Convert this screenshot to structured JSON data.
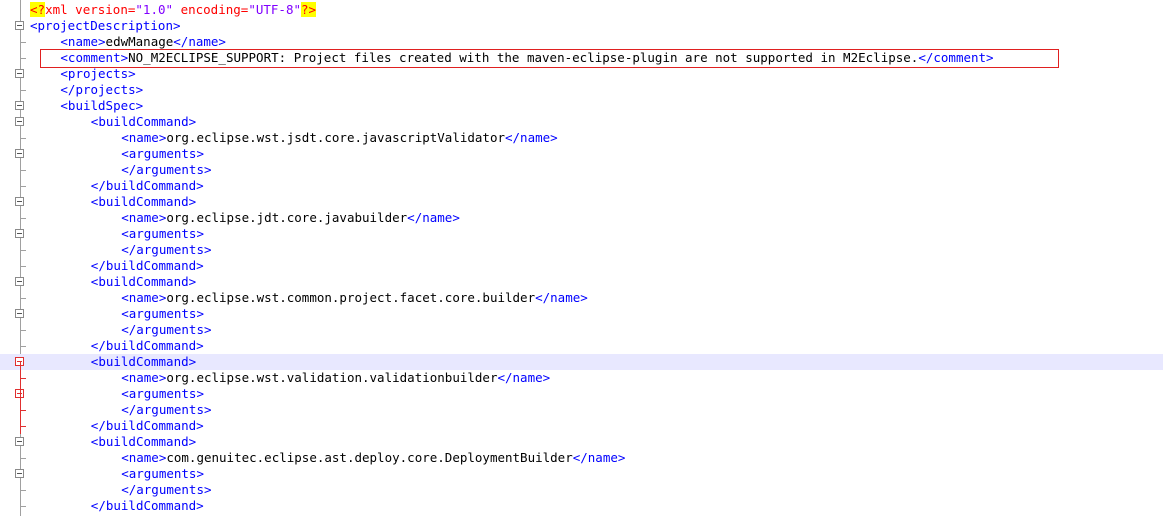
{
  "editor": {
    "xml_decl": {
      "open": "<?",
      "name": "xml",
      "attr1_name": "version",
      "attr1_value": "\"1.0\"",
      "attr2_name": "encoding",
      "attr2_value": "\"UTF-8\"",
      "close": "?>"
    },
    "lines": [
      {
        "indent": 0,
        "tag": "<projectDescription>",
        "fold": true
      },
      {
        "indent": 4,
        "tag": "<name>",
        "text": "edwManage",
        "end": "</name>"
      },
      {
        "indent": 4,
        "tag": "<comment>",
        "text": "NO_M2ECLIPSE_SUPPORT: Project files created with the maven-eclipse-plugin are not supported in M2Eclipse.",
        "end": "</comment>",
        "boxed": true
      },
      {
        "indent": 4,
        "tag": "<projects>",
        "fold": true
      },
      {
        "indent": 4,
        "tag": "</projects>",
        "foldEnd": true
      },
      {
        "indent": 4,
        "tag": "<buildSpec>",
        "fold": true
      },
      {
        "indent": 8,
        "tag": "<buildCommand>",
        "fold": true
      },
      {
        "indent": 12,
        "tag": "<name>",
        "text": "org.eclipse.wst.jsdt.core.javascriptValidator",
        "end": "</name>"
      },
      {
        "indent": 12,
        "tag": "<arguments>",
        "fold": true
      },
      {
        "indent": 12,
        "tag": "</arguments>",
        "foldEnd": true
      },
      {
        "indent": 8,
        "tag": "</buildCommand>",
        "foldEnd": true
      },
      {
        "indent": 8,
        "tag": "<buildCommand>",
        "fold": true
      },
      {
        "indent": 12,
        "tag": "<name>",
        "text": "org.eclipse.jdt.core.javabuilder",
        "end": "</name>"
      },
      {
        "indent": 12,
        "tag": "<arguments>",
        "fold": true
      },
      {
        "indent": 12,
        "tag": "</arguments>",
        "foldEnd": true
      },
      {
        "indent": 8,
        "tag": "</buildCommand>",
        "foldEnd": true
      },
      {
        "indent": 8,
        "tag": "<buildCommand>",
        "fold": true
      },
      {
        "indent": 12,
        "tag": "<name>",
        "text": "org.eclipse.wst.common.project.facet.core.builder",
        "end": "</name>"
      },
      {
        "indent": 12,
        "tag": "<arguments>",
        "fold": true
      },
      {
        "indent": 12,
        "tag": "</arguments>",
        "foldEnd": true
      },
      {
        "indent": 8,
        "tag": "</buildCommand>",
        "foldEnd": true
      },
      {
        "indent": 8,
        "tag": "<buildCommand>",
        "fold": true,
        "current": true,
        "red": true
      },
      {
        "indent": 12,
        "tag": "<name>",
        "text": "org.eclipse.wst.validation.validationbuilder",
        "end": "</name>",
        "red": true
      },
      {
        "indent": 12,
        "tag": "<arguments>",
        "fold": true,
        "red": true
      },
      {
        "indent": 12,
        "tag": "</arguments>",
        "foldEnd": true,
        "red": true
      },
      {
        "indent": 8,
        "tag": "</buildCommand>",
        "foldEnd": true,
        "red": true
      },
      {
        "indent": 8,
        "tag": "<buildCommand>",
        "fold": true
      },
      {
        "indent": 12,
        "tag": "<name>",
        "text": "com.genuitec.eclipse.ast.deploy.core.DeploymentBuilder",
        "end": "</name>"
      },
      {
        "indent": 12,
        "tag": "<arguments>",
        "fold": true
      },
      {
        "indent": 12,
        "tag": "</arguments>",
        "foldEnd": true
      },
      {
        "indent": 8,
        "tag": "</buildCommand>",
        "foldEnd": true
      }
    ]
  },
  "colors": {
    "tag": "#0000ff",
    "text": "#000000",
    "processing_instruction": "#ff0000",
    "pi_highlight": "#ffff00",
    "attribute_value": "#8000ff",
    "current_line": "#e8e8ff",
    "annotation_box": "#e02020"
  }
}
